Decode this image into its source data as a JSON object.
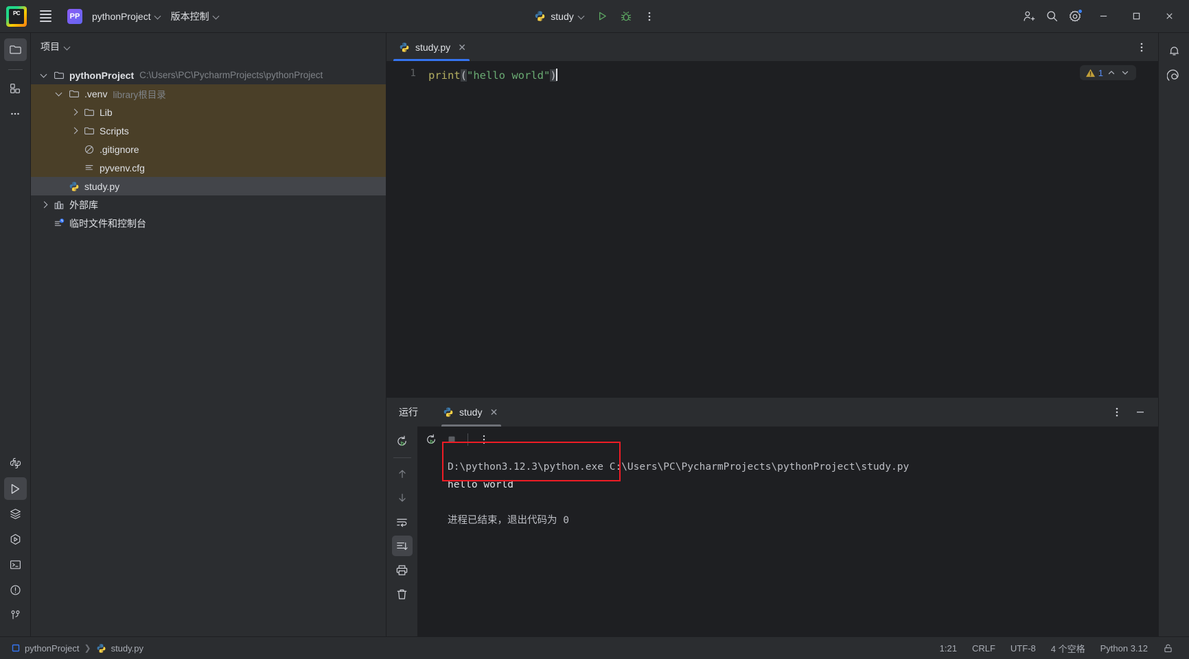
{
  "titlebar": {
    "logo_text": "PC",
    "menu_icon": "hamburger-menu-icon",
    "project_badge": "PP",
    "project_name": "pythonProject",
    "vcs_label": "版本控制",
    "run_config_name": "study",
    "run_icon": "run-triangle-icon",
    "debug_icon": "debug-bug-icon",
    "more_icon": "more-vertical-icon",
    "add_user_icon": "add-user-icon",
    "search_icon": "search-icon",
    "settings_icon": "gear-icon",
    "minimize_icon": "minimize-icon",
    "maximize_icon": "maximize-icon",
    "close_icon": "close-icon",
    "accent_blue": "#3574f0",
    "run_green": "#5fad65"
  },
  "left_rail": {
    "top": [
      {
        "name": "project-tool-window",
        "icon": "folder-icon",
        "active": true
      },
      {
        "name": "commit-tool-window",
        "icon": "structure-blocks-icon",
        "active": false
      },
      {
        "name": "more-tool-windows",
        "icon": "more-horizontal-icon",
        "active": false
      }
    ],
    "bottom": [
      {
        "name": "python-console",
        "icon": "python-icon",
        "active": false
      },
      {
        "name": "run-tool-window",
        "icon": "run-triangle-icon",
        "active": true
      },
      {
        "name": "services-tool-window",
        "icon": "layers-icon",
        "active": false
      },
      {
        "name": "profiler-tool-window",
        "icon": "hex-play-icon",
        "active": false
      },
      {
        "name": "terminal-tool-window",
        "icon": "terminal-icon",
        "active": false
      },
      {
        "name": "problems-tool-window",
        "icon": "warning-circle-icon",
        "active": false
      },
      {
        "name": "version-control-tool-window",
        "icon": "branch-icon",
        "active": false
      }
    ]
  },
  "right_rail": [
    {
      "name": "notifications",
      "icon": "bell-icon"
    },
    {
      "name": "ai-assistant",
      "icon": "spiral-ai-icon"
    }
  ],
  "project_panel": {
    "title": "项目",
    "tree": [
      {
        "depth": 0,
        "arrow": "open",
        "icon": "folder-icon",
        "label": "pythonProject",
        "bold": true,
        "sub": "C:\\Users\\PC\\PycharmProjects\\pythonProject",
        "state": "normal"
      },
      {
        "depth": 1,
        "arrow": "open",
        "icon": "folder-icon",
        "label": ".venv",
        "bold": false,
        "sub": "library根目录",
        "state": "venv"
      },
      {
        "depth": 2,
        "arrow": "closed",
        "icon": "folder-icon",
        "label": "Lib",
        "bold": false,
        "sub": "",
        "state": "venv"
      },
      {
        "depth": 2,
        "arrow": "closed",
        "icon": "folder-icon",
        "label": "Scripts",
        "bold": false,
        "sub": "",
        "state": "venv"
      },
      {
        "depth": 2,
        "arrow": "none",
        "icon": "gitignore-icon",
        "label": ".gitignore",
        "bold": false,
        "sub": "",
        "state": "venv"
      },
      {
        "depth": 2,
        "arrow": "none",
        "icon": "config-icon",
        "label": "pyvenv.cfg",
        "bold": false,
        "sub": "",
        "state": "venv"
      },
      {
        "depth": 1,
        "arrow": "none",
        "icon": "python-icon",
        "label": "study.py",
        "bold": false,
        "sub": "",
        "state": "selected"
      },
      {
        "depth": 0,
        "arrow": "closed",
        "icon": "library-icon",
        "label": "外部库",
        "bold": false,
        "sub": "",
        "state": "normal"
      },
      {
        "depth": 0,
        "arrow": "none",
        "icon": "scratches-icon",
        "label": "临时文件和控制台",
        "bold": false,
        "sub": "",
        "state": "normal"
      }
    ]
  },
  "editor": {
    "tab_label": "study.py",
    "tab_icon": "python-icon",
    "tab_close_icon": "close-icon",
    "options_icon": "more-vertical-icon",
    "line_number": "1",
    "code": {
      "fn": "print",
      "open_paren": "(",
      "string": "\"hello world\"",
      "close_paren": ")"
    },
    "inspection": {
      "icon": "warning-triangle-icon",
      "count": "1",
      "prev_icon": "chevron-up-icon",
      "next_icon": "chevron-down-icon"
    }
  },
  "run_panel": {
    "title": "运行",
    "tab_label": "study",
    "tab_icon": "python-icon",
    "tab_close_icon": "close-icon",
    "options_icon": "more-vertical-icon",
    "minimize_icon": "minimize-icon",
    "toolbar": [
      {
        "name": "rerun-button",
        "icon": "rerun-icon",
        "active": false
      },
      {
        "name": "scroll-up-button",
        "icon": "arrow-up-icon",
        "active": false
      },
      {
        "name": "scroll-down-button",
        "icon": "arrow-down-icon",
        "active": false
      },
      {
        "name": "soft-wrap-button",
        "icon": "soft-wrap-icon",
        "active": false
      },
      {
        "name": "scroll-to-end-button",
        "icon": "scroll-to-end-icon",
        "active": true
      },
      {
        "name": "print-button",
        "icon": "print-icon",
        "active": false
      },
      {
        "name": "clear-all-button",
        "icon": "trash-icon",
        "active": false
      }
    ],
    "console_toolbar": [
      {
        "name": "rerun-program-button",
        "icon": "rerun-icon"
      },
      {
        "name": "stop-program-button",
        "icon": "stop-square-icon"
      },
      {
        "name": "console-more-button",
        "icon": "more-vertical-icon"
      }
    ],
    "console": {
      "command_exe": "D:\\python3.12.3\\python.exe",
      "command_script": "C:\\Users\\PC\\PycharmProjects\\pythonProject\\study.py",
      "output": "hello world",
      "exit_message": "进程已结束，退出代码为 0"
    },
    "annotation_color": "#ee1c25"
  },
  "statusbar": {
    "crumb_project": "pythonProject",
    "crumb_file": "study.py",
    "crumb_project_icon": "module-square-icon",
    "crumb_file_icon": "python-icon",
    "caret_position": "1:21",
    "line_separator": "CRLF",
    "encoding": "UTF-8",
    "indent": "4 个空格",
    "interpreter": "Python 3.12",
    "lock_icon": "unlocked-icon"
  }
}
